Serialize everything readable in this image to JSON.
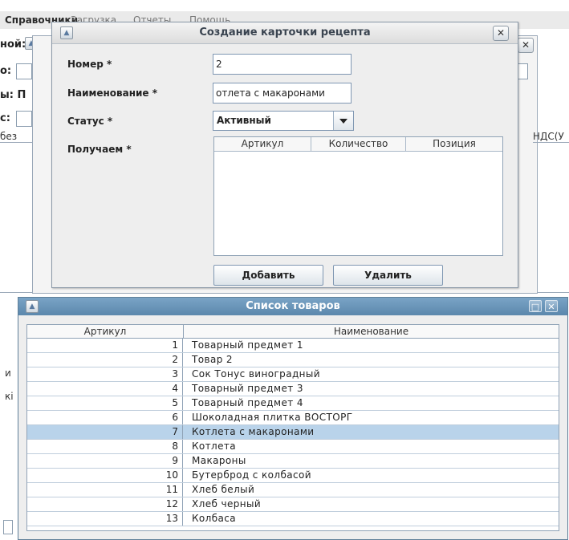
{
  "menu": {
    "items": [
      "Справочники",
      "Загрузка",
      "Отчеты",
      "Помощь"
    ]
  },
  "background": {
    "labels": [
      "ной:",
      "о:",
      "ы: П",
      "с:",
      "без"
    ],
    "right_text": "НДС(У",
    "left_text_1": "и",
    "left_text_2": "кі"
  },
  "dialog": {
    "title": "Создание карточки рецепта",
    "close_glyph": "✕",
    "number_label": "Номер *",
    "number_value": "2",
    "name_label": "Наименование *",
    "name_value": "отлета с макаронами",
    "status_label": "Статус *",
    "status_value": "Активный",
    "receive_label": "Получаем *",
    "grid_columns": [
      "Артикул",
      "Количество",
      "Позиция"
    ],
    "add_button": "Добавить",
    "delete_button": "Удалить"
  },
  "product_list": {
    "title": "Список товаров",
    "columns": [
      "Артикул",
      "Наименование"
    ],
    "selected_article": "7",
    "rows": [
      {
        "article": "1",
        "name": "Товарный предмет 1"
      },
      {
        "article": "2",
        "name": "Товар 2"
      },
      {
        "article": "3",
        "name": "Сок Тонус виноградный"
      },
      {
        "article": "4",
        "name": "Товарный предмет 3"
      },
      {
        "article": "5",
        "name": "Товарный предмет 4"
      },
      {
        "article": "6",
        "name": "Шоколадная плитка ВОСТОРГ"
      },
      {
        "article": "7",
        "name": "Котлета с макаронами"
      },
      {
        "article": "8",
        "name": "Котлета"
      },
      {
        "article": "9",
        "name": "Макароны"
      },
      {
        "article": "10",
        "name": "Бутерброд с колбасой"
      },
      {
        "article": "11",
        "name": "Хлеб белый"
      },
      {
        "article": "12",
        "name": "Хлеб черный"
      },
      {
        "article": "13",
        "name": "Колбаса"
      }
    ]
  },
  "colors": {
    "title_bar_active": "#6b95b9",
    "selection": "#b9d3ea",
    "border": "#8fa2b6"
  }
}
